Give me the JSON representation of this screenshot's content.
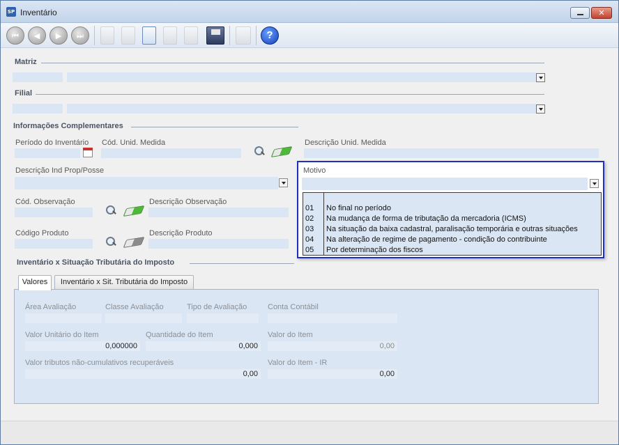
{
  "window": {
    "title": "Inventário",
    "app_badge": "SP"
  },
  "toolbar": {
    "nav_first": "first-record",
    "nav_prev": "previous-record",
    "nav_next": "next-record",
    "nav_last": "last-record",
    "help_label": "?"
  },
  "sections": {
    "matriz": "Matriz",
    "filial": "Filial",
    "info_comp": "Informações Complementares",
    "inv_sit": "Inventário x Situação Tributária do Imposto"
  },
  "fields": {
    "periodo": "Período do Inventário",
    "cod_unid": "Cód. Unid. Medida",
    "desc_unid": "Descrição Unid. Medida",
    "desc_ind": "Descrição Ind Prop/Posse",
    "motivo": "Motivo",
    "cod_obs": "Cód. Observação",
    "desc_obs": "Descrição Observação",
    "cod_prod": "Código Produto",
    "desc_prod": "Descrição Produto"
  },
  "motivo_options": [
    {
      "code": "01",
      "desc": "No final no período"
    },
    {
      "code": "02",
      "desc": "Na mudança de forma de tributação da mercadoria (ICMS)"
    },
    {
      "code": "03",
      "desc": "Na situação da baixa cadastral, paralisação temporária e outras situações"
    },
    {
      "code": "04",
      "desc": "Na alteração de regime de pagamento - condição do contribuinte"
    },
    {
      "code": "05",
      "desc": "Por determinação dos fiscos"
    }
  ],
  "tabs": [
    "Valores",
    "Inventário x Sit. Tributária do Imposto"
  ],
  "valores": {
    "area": "Área Avaliação",
    "classe": "Classe Avaliação",
    "tipo": "Tipo de Avaliação",
    "conta": "Conta Contábil",
    "valor_unit_label": "Valor Unitário do Item",
    "valor_unit": "0,000000",
    "quantidade_label": "Quantidade do Item",
    "quantidade": "0,000",
    "valor_item_label": "Valor do Item",
    "valor_item": "0,00",
    "tributos_label": "Valor tributos não-cumulativos recuperáveis",
    "tributos": "0,00",
    "valor_ir_label": "Valor do Item - IR",
    "valor_ir": "0,00"
  }
}
